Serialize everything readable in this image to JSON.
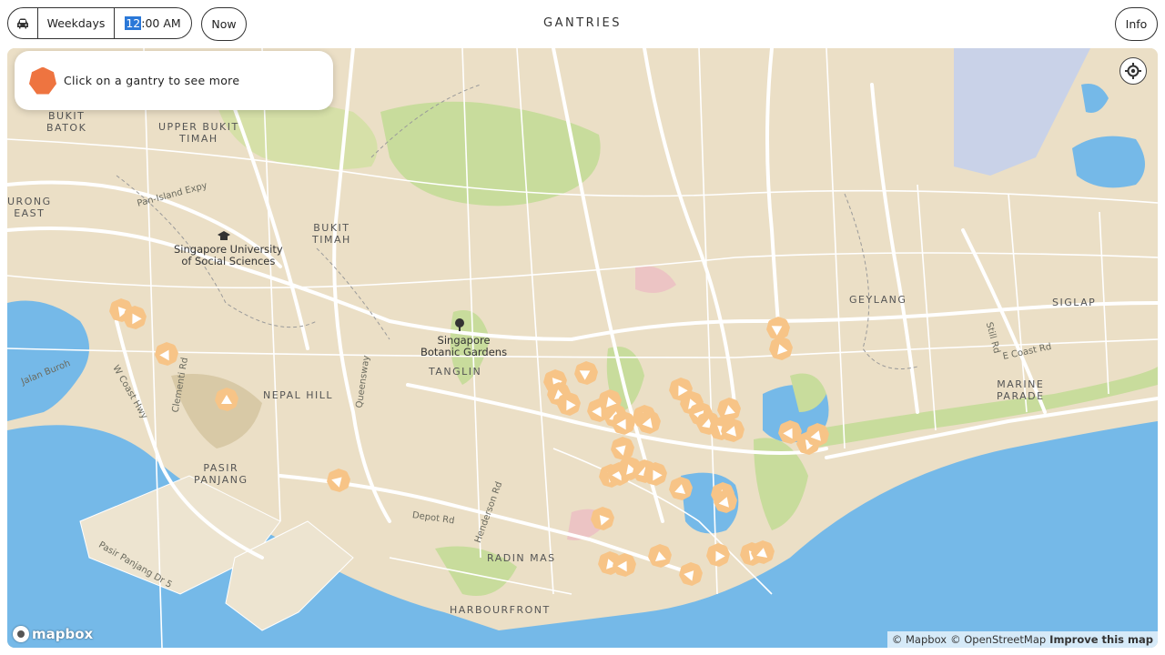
{
  "header": {
    "vehicle_icon": "car-icon",
    "day_type": "Weekdays",
    "time_hour_highlighted": "12",
    "time_rest": ":00 AM",
    "now_button": "Now",
    "title": "GANTRIES",
    "info_button": "Info"
  },
  "info_card": {
    "icon": "gantry-marker-icon",
    "text": "Click on a gantry to see more"
  },
  "map": {
    "locate_icon": "locate-icon",
    "colors": {
      "land": "#ebdfc6",
      "water": "#75b9e8",
      "park": "#c8dc9c",
      "road": "#ffffff",
      "gantry": "#f7c487",
      "accent": "#ee7440"
    },
    "area_labels": [
      {
        "id": "bukit-batok",
        "text": "BUKIT\nBATOK"
      },
      {
        "id": "upper-bukit-timah",
        "text": "UPPER BUKIT\nTIMAH"
      },
      {
        "id": "jurong-east",
        "text": "URONG\nEAST"
      },
      {
        "id": "bukit-timah",
        "text": "BUKIT\nTIMAH"
      },
      {
        "id": "tanglin",
        "text": "TANGLIN"
      },
      {
        "id": "nepal-hill",
        "text": "NEPAL HILL"
      },
      {
        "id": "pasir-panjang",
        "text": "PASIR\nPANJANG"
      },
      {
        "id": "radin-mas",
        "text": "RADIN MAS"
      },
      {
        "id": "harbourfront",
        "text": "HARBOURFRONT"
      },
      {
        "id": "geylang",
        "text": "GEYLANG"
      },
      {
        "id": "siglap",
        "text": "SIGLAP"
      },
      {
        "id": "marine-parade",
        "text": "MARINE\nPARADE"
      }
    ],
    "poi_labels": [
      {
        "id": "suss",
        "text": "Singapore University\nof Social Sciences",
        "icon": "university-icon"
      },
      {
        "id": "botanic",
        "text": "Singapore\nBotanic Gardens",
        "icon": "garden-icon"
      }
    ],
    "road_labels": [
      {
        "id": "pie",
        "text": "Pan-Island Expy"
      },
      {
        "id": "jalan-buroh",
        "text": "Jalan Buroh"
      },
      {
        "id": "w-coast-hwy",
        "text": "W Coast Hwy"
      },
      {
        "id": "clementi-rd",
        "text": "Clementi Rd"
      },
      {
        "id": "queensway",
        "text": "Queensway"
      },
      {
        "id": "depot-rd",
        "text": "Depot Rd"
      },
      {
        "id": "henderson-rd",
        "text": "Henderson Rd"
      },
      {
        "id": "pasir-panjang-dr",
        "text": "Pasir Panjang Dr 5"
      },
      {
        "id": "still-rd",
        "text": "Still Rd"
      },
      {
        "id": "e-coast-rd",
        "text": "E Coast Rd"
      }
    ],
    "gantry_count": 48
  },
  "attribution": {
    "logo": "mapbox",
    "mapbox": "© Mapbox",
    "osm": "© OpenStreetMap",
    "improve": "Improve this map"
  }
}
